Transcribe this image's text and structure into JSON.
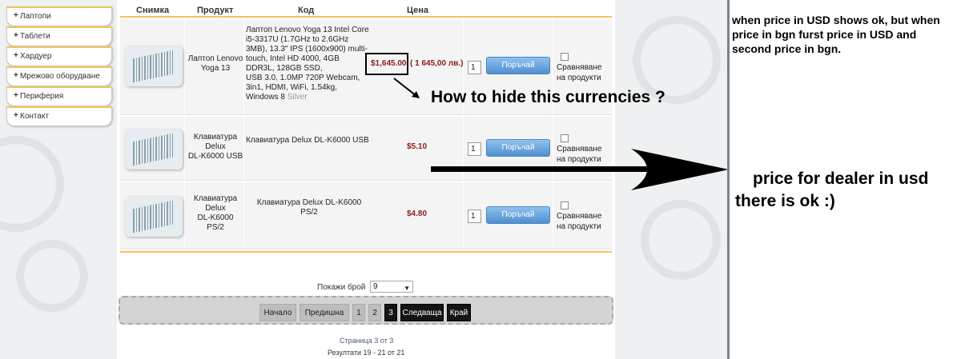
{
  "sidebar": {
    "items": [
      {
        "label": "Лаптопи"
      },
      {
        "label": "Таблети"
      },
      {
        "label": "Хардуер"
      },
      {
        "label": "Мрежово оборудване"
      },
      {
        "label": "Периферия"
      },
      {
        "label": "Контакт"
      }
    ],
    "bullet": "+"
  },
  "table": {
    "headers": [
      "Снимка",
      "Продукт",
      "Код",
      "Цена"
    ],
    "rows": [
      {
        "name": "Лаптоп Lenovo Yoga 13",
        "desc_lines": [
          "Лаптоп Lenovo Yoga 13 Intel Core",
          "i5-3317U (1.7GHz to 2.6GHz",
          "3MB), 13.3\" IPS (1600x900) multi-",
          "touch, Intel HD 4000, 4GB",
          "DDR3L, 128GB SSD,",
          "USB 3.0, 1.0MP 720P Webcam,",
          "3in1, HDMI, WiFi, 1.54kg,"
        ],
        "desc_last": "Windows 8",
        "desc_muted": "Silver",
        "price_usd": "$1,645.00",
        "price_bgn": "( 1 645,00 лв.)",
        "qty": "1",
        "buy": "Поръчай",
        "compare_1": "Сравняване",
        "compare_2": "на продукти"
      },
      {
        "name_lines": [
          "Клавиатура",
          "Delux",
          "DL-K6000 USB"
        ],
        "desc": "Клавиатура Delux DL-K6000 USB",
        "price": "$5.10",
        "qty": "1",
        "buy": "Поръчай",
        "compare_1": "Сравняване",
        "compare_2": "на продукти"
      },
      {
        "name_lines": [
          "Клавиатура",
          "Delux",
          "DL-K6000",
          "PS/2"
        ],
        "desc_lines": [
          "Клавиатура Delux DL-K6000",
          "PS/2"
        ],
        "price": "$4.80",
        "qty": "1",
        "buy": "Поръчай",
        "compare_1": "Сравняване",
        "compare_2": "на продукти"
      }
    ]
  },
  "perpage": {
    "label": "Покажи брой",
    "value": "9"
  },
  "pager": {
    "first": "Начало",
    "prev": "Предишна",
    "pages": [
      "1",
      "2",
      "3"
    ],
    "current": "3",
    "next": "Следваща",
    "last": "Край"
  },
  "page_info": "Страница 3 от 3",
  "results_info": "Резултати 19 - 21 от 21",
  "annotations": {
    "question": "How to hide this  currencies ?",
    "right_note": "when price in USD shows ok, but when price in bgn furst price in USD and second price in bgn.",
    "dealer_note_1": "price for dealer in usd",
    "dealer_note_2": "there is ok :)"
  },
  "colors": {
    "price": "#8b1a1a",
    "accent": "#f0c45a",
    "button": "#4f8fcf"
  }
}
